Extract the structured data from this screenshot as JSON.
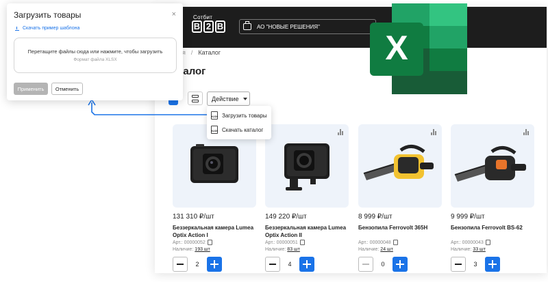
{
  "header": {
    "logo_small": "Сотбит",
    "logo_letters": [
      "B",
      "2",
      "B"
    ],
    "company_name": "АО \"НОВЫЕ РЕШЕНИЯ\""
  },
  "breadcrumb": {
    "home": "ная",
    "separator": "/",
    "current": "Каталог"
  },
  "page_title": "талог",
  "toolbar": {
    "action_label": "Действие"
  },
  "dropdown": {
    "items": [
      {
        "label": "Загрузить товары",
        "icon_text": "XLSX"
      },
      {
        "label": "Скачать каталог",
        "icon_text": "XLSX"
      }
    ]
  },
  "modal": {
    "title": "Загрузить товары",
    "close": "×",
    "template_link": "Скачать пример шаблона",
    "dropzone_main": "Перетащите файлы сюда или нажмите, чтобы загрузить",
    "dropzone_sub": "Формат файла XLSX",
    "apply_label": "Применить",
    "cancel_label": "Отменить"
  },
  "excel_logo": {
    "letter": "X"
  },
  "products": [
    {
      "price": "131 310 ₽/шт",
      "name": "Беззеркальная камера Lumea Optix Action I",
      "art": "Арт.: 00000052",
      "stock_label": "Наличие:",
      "stock": "193 шт",
      "qty": "2",
      "image": "camera-image",
      "minus_disabled": false
    },
    {
      "price": "149 220 ₽/шт",
      "name": "Беззеркальная камера Lumea Optix Action II",
      "art": "Арт.: 00000051",
      "stock_label": "Наличие:",
      "stock": "83 шт",
      "qty": "4",
      "image": "camera-mount-image",
      "minus_disabled": false
    },
    {
      "price": "8 999 ₽/шт",
      "name": "Бензопила Ferrovolt 365H",
      "art": "Арт.: 00000048",
      "stock_label": "Наличие:",
      "stock": "24 шт",
      "qty": "0",
      "image": "chainsaw-yellow-image",
      "minus_disabled": true
    },
    {
      "price": "9 999 ₽/шт",
      "name": "Бензопила Ferrovolt BS-62",
      "art": "Арт.: 00000043",
      "stock_label": "Наличие:",
      "stock": "33 шт",
      "qty": "3",
      "image": "chainsaw-orange-image",
      "minus_disabled": false
    }
  ],
  "colors": {
    "accent": "#1a73e8",
    "topbar": "#1d1d1d",
    "card_bg": "#eef3fa",
    "excel_green": "#107c41"
  }
}
